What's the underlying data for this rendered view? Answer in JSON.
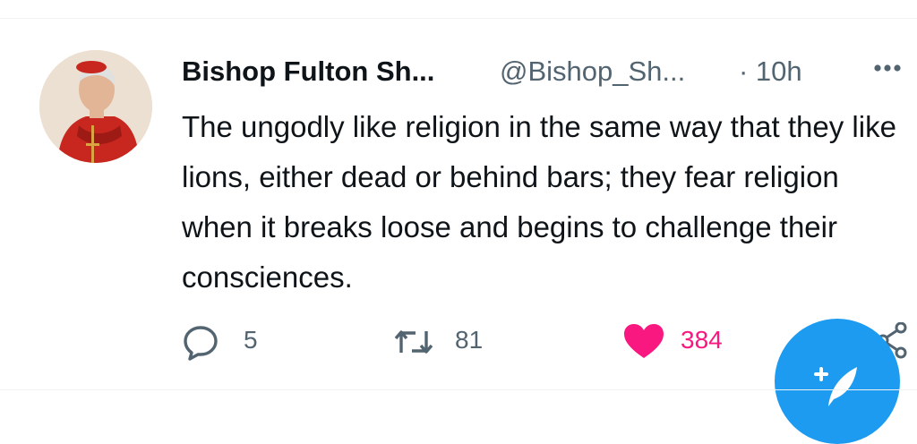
{
  "tweet": {
    "author_name": "Bishop Fulton Sh...",
    "handle": "@Bishop_Sh...",
    "time": "· 10h",
    "text": "The ungodly like religion in the same way that they like lions, either dead or behind bars; they fear religion when it breaks loose and begins to challenge their consciences.",
    "avatar_icon": "bishop-portrait"
  },
  "actions": {
    "reply_count": "5",
    "retweet_count": "81",
    "like_count": "384",
    "liked": true
  },
  "colors": {
    "text_primary": "#0f1419",
    "text_secondary": "#536471",
    "like": "#f91880",
    "accent": "#1d9bf0"
  },
  "icons": {
    "more": "more-horizontal-icon",
    "reply": "reply-bubble-icon",
    "retweet": "retweet-icon",
    "like": "heart-icon",
    "share": "share-icon",
    "compose": "compose-feather-icon"
  }
}
